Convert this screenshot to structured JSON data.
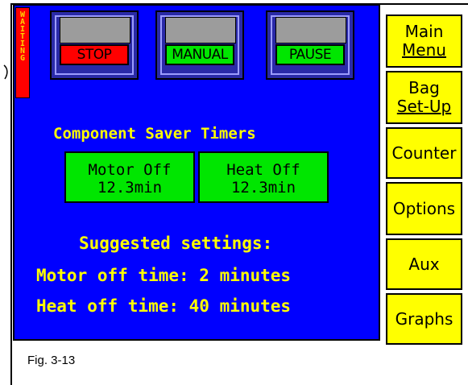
{
  "status": {
    "letters": [
      "W",
      "A",
      "I",
      "T",
      "I",
      "N",
      "G"
    ]
  },
  "mode_buttons": [
    {
      "label": "STOP",
      "color": "#ff0000"
    },
    {
      "label": "MANUAL",
      "color": "#00e600"
    },
    {
      "label": "PAUSE",
      "color": "#00e600"
    }
  ],
  "timers": {
    "heading": "Component Saver Timers",
    "motor": {
      "line1": "Motor Off",
      "line2": "12.3min"
    },
    "heat": {
      "line1": "Heat Off",
      "line2": "12.3min"
    }
  },
  "suggested": {
    "title": "Suggested settings:",
    "motor": "Motor off time: 2 minutes",
    "heat": "Heat off time: 40 minutes"
  },
  "side_menu": {
    "main_menu": {
      "line1": "Main",
      "line2": "Menu"
    },
    "bag_setup": {
      "line1": "Bag",
      "line2": "Set-Up"
    },
    "counter": "Counter",
    "options": "Options",
    "aux": "Aux",
    "graphs": "Graphs"
  },
  "caption": "Fig. 3-13",
  "colors": {
    "screen": "#0000ff",
    "button_yellow": "#ffff00",
    "accent_green": "#00e600",
    "alert_red": "#ff0000"
  }
}
